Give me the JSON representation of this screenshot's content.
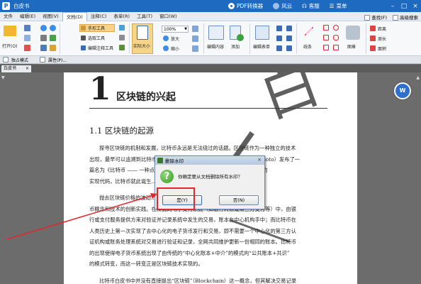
{
  "app": {
    "title": "白皮书",
    "logo_letter": "P",
    "pdf_convert": "PDF转换器",
    "user": "风云",
    "help": "客服",
    "menu": "菜单"
  },
  "menubar": {
    "items": [
      "文件",
      "编辑(E)",
      "视图(V)",
      "文档(D)",
      "注释(C)",
      "表单(R)",
      "工具(T)",
      "窗口(W)"
    ],
    "active_index": 3,
    "find": "查找(F)",
    "advanced_search": "高级搜索"
  },
  "ribbon": {
    "open": "打开(O)",
    "hand_tool": "手形工具",
    "select_tool": "选取工具",
    "edit_annot": "编辑注释工具",
    "actual_size": "实际大小",
    "zoom_value": "100%",
    "zoom_in": "放大",
    "zoom_out": "缩小",
    "edit_content": "编辑内容",
    "add": "添加",
    "edit_form": "编辑表单",
    "line": "线条",
    "shape": "图章",
    "distance": "距离",
    "perimeter": "周长",
    "area": "面积"
  },
  "docstrip": {
    "mode": "独占模式",
    "properties": "属性(P)..."
  },
  "tab": {
    "label": "白皮书"
  },
  "page": {
    "chapter_num": "1",
    "chapter_title": "区块链的兴起",
    "section_title": "1.1 区块链的起源",
    "para1": [
      "探寻区块链的机制和发展，比特币永远是无法绕过的话题。区块链作为一种独立的技术",
      "出现，最早可以追溯到比特币...2008年11月1日，中本聪（Satoshi Nakamoto）发布了一",
      "篇名为《比特币 —— 一种点对点的电子现金系统》...2009 年公开了其早期的",
      "实现代码，比特币就此诞生..."
    ],
    "para2": [
      "抛去区块链价格的波动...比特币自身所具备的...可以把它视作一次电子货",
      "币概念和技术的创新实践。在传统的电子支付系统（如银行转账或第三方支付等）中，由银",
      "行或支付服务提供方来对验证并记录系统中发生的交易，账本在中心机构手中；而比特币在",
      "人类历史上第一次实现了去中心化的电子货币发行和交易，即不需要一个中心化的第三方认",
      "证机构或账务处理系统对交易进行验证和记录，全网共同维护更新一份相同的账本。比特币",
      "的出现使得电子货币系统出现了由传统的“中心化账本+中介”的模式向“公共账本+共识”",
      "的模式转变，而这一转变正是区块链技术实现的。"
    ],
    "para3": "比特币白皮书中并没有直接提出“区块链”（Blockchain）这一概念，但其解决交易记录"
  },
  "watermark": {
    "text": "白皮书"
  },
  "dialog": {
    "title": "删除水印",
    "message": "你确定要从文档删除所有水印？",
    "yes": "是(Y)",
    "no": "否(N)",
    "close": "×",
    "question_mark": "?"
  },
  "fab": {
    "label": "W"
  },
  "colors": {
    "titlebar": "#1d6ac0",
    "highlight": "#e0282d",
    "workspace": "#6c6c6c"
  }
}
